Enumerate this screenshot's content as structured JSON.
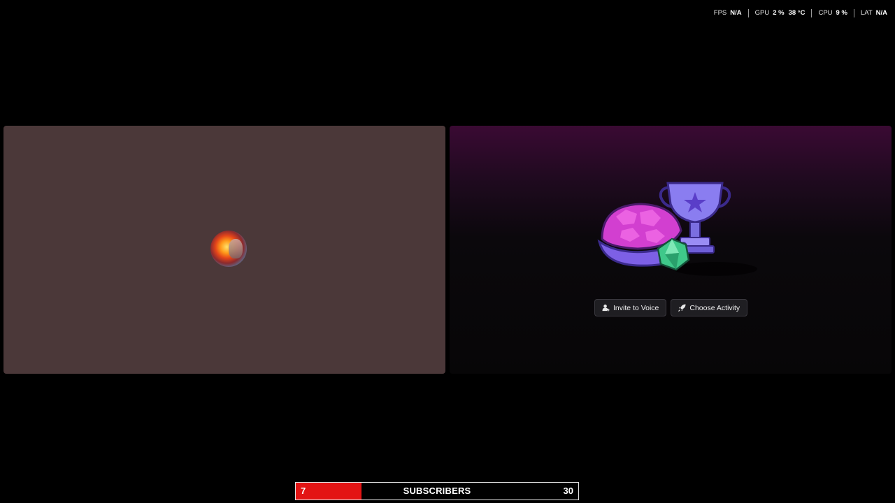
{
  "perf_overlay": {
    "fps": {
      "label": "FPS",
      "value": "N/A"
    },
    "gpu": {
      "label": "GPU",
      "usage": "2 %",
      "temp": "38 °C"
    },
    "cpu": {
      "label": "CPU",
      "usage": "9 %"
    },
    "lat": {
      "label": "LAT",
      "value": "N/A"
    }
  },
  "user_tile": {
    "avatar_icon": "user-avatar"
  },
  "activity_tile": {
    "illustration_icon": "activity-trophy-shell-dice-illustration",
    "invite_button": {
      "label": "Invite to Voice",
      "icon": "user-plus-icon"
    },
    "activity_button": {
      "label": "Choose Activity",
      "icon": "rocket-icon"
    }
  },
  "subscriber_goal": {
    "current": "7",
    "label": "SUBSCRIBERS",
    "target": "30",
    "progress": 0.2333,
    "fill_color": "#e31414"
  }
}
